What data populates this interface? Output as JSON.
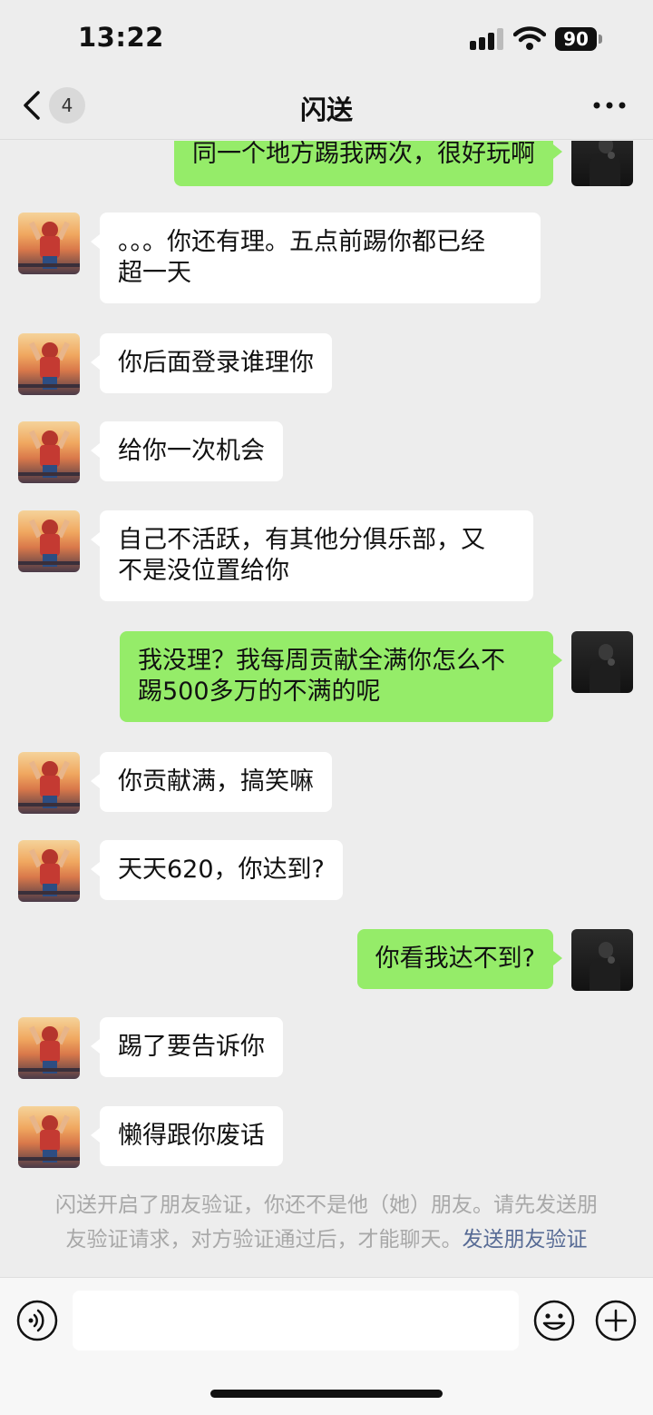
{
  "status_bar": {
    "time": "13:22",
    "battery": "90"
  },
  "nav": {
    "back_count": "4",
    "title": "闪送"
  },
  "messages": [
    {
      "side": "out",
      "text": "同一个地方踢我两次，很好玩啊"
    },
    {
      "side": "in",
      "text": "。。。你还有理。五点前踢你都已经\n超一天"
    },
    {
      "side": "in",
      "text": "你后面登录谁理你"
    },
    {
      "side": "in",
      "text": "给你一次机会"
    },
    {
      "side": "in",
      "text": "自己不活跃，有其他分俱乐部，又\n不是没位置给你"
    },
    {
      "side": "out",
      "text": "我没理？我每周贡献全满你怎么不\n踢500多万的不满的呢"
    },
    {
      "side": "in",
      "text": "你贡献满，搞笑嘛"
    },
    {
      "side": "in",
      "text": "天天620，你达到?"
    },
    {
      "side": "out",
      "text": "你看我达不到?"
    },
    {
      "side": "in",
      "text": "踢了要告诉你"
    },
    {
      "side": "in",
      "text": "懒得跟你废话"
    }
  ],
  "system_note": {
    "text": "闪送开启了朋友验证，你还不是他（她）朋友。请先发送朋友验证请求，对方验证通过后，才能聊天。",
    "link": "发送朋友验证"
  },
  "input": {
    "value": ""
  },
  "colors": {
    "outgoing_bubble": "#95ec69",
    "incoming_bubble": "#ffffff",
    "background": "#ededed",
    "link": "#576b95"
  },
  "icons": [
    "back-icon",
    "more-icon",
    "voice-icon",
    "emoji-icon",
    "plus-icon",
    "signal-icon",
    "wifi-icon"
  ]
}
